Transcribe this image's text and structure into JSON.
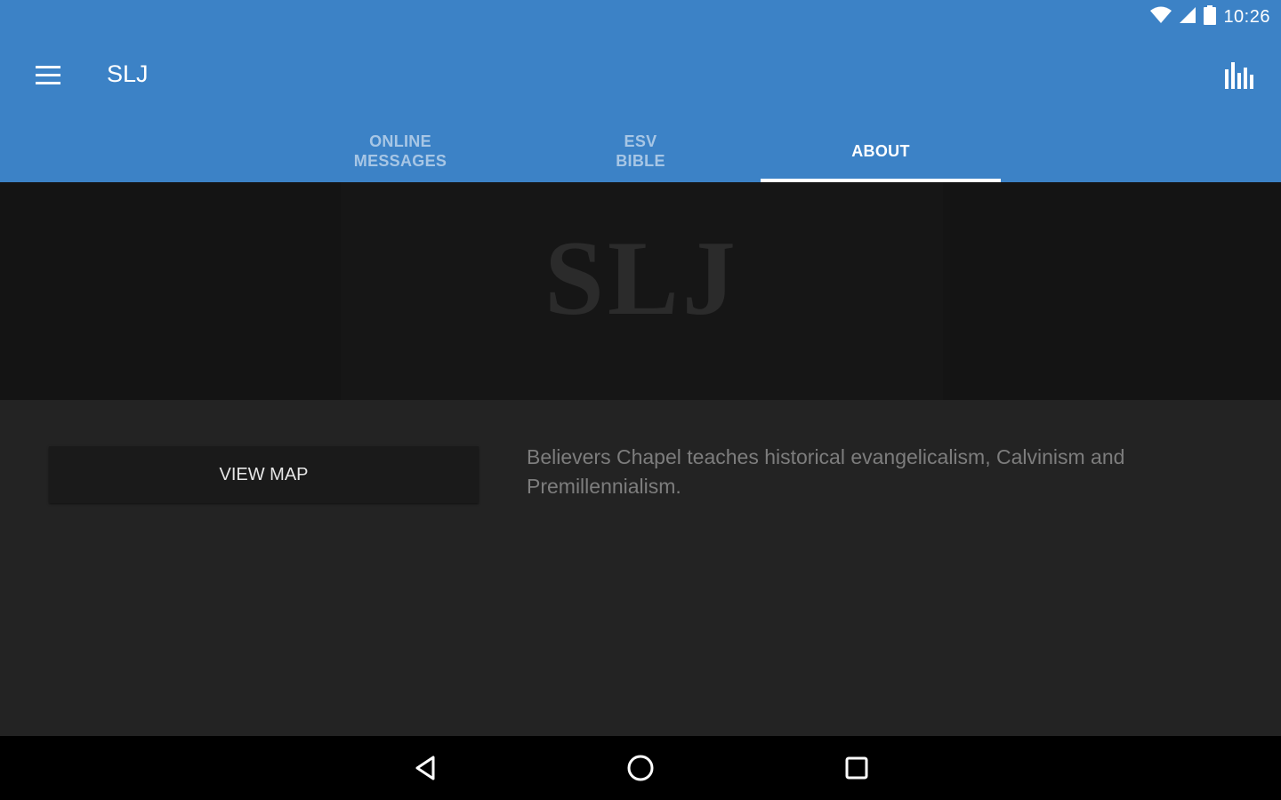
{
  "status_bar": {
    "time": "10:26",
    "icons": [
      "wifi-icon",
      "cell-signal-icon",
      "battery-icon"
    ]
  },
  "toolbar": {
    "title": "SLJ",
    "menu_icon": "hamburger-menu-icon",
    "action_icon": "bar-chart-icon"
  },
  "tabs": [
    {
      "label": "ONLINE\nMESSAGES",
      "active": false
    },
    {
      "label": "ESV\nBIBLE",
      "active": false
    },
    {
      "label": "ABOUT",
      "active": true
    }
  ],
  "banner": {
    "logo_text": "SLJ"
  },
  "about": {
    "map_button_label": "VIEW MAP",
    "description": "Believers Chapel teaches historical evangelicalism, Calvinism and Premillennialism."
  },
  "nav_bar": {
    "icons": [
      "back-icon",
      "home-icon",
      "recents-icon"
    ]
  },
  "colors": {
    "primary": "#3c82c6",
    "background": "#232323",
    "banner": "#141414"
  }
}
